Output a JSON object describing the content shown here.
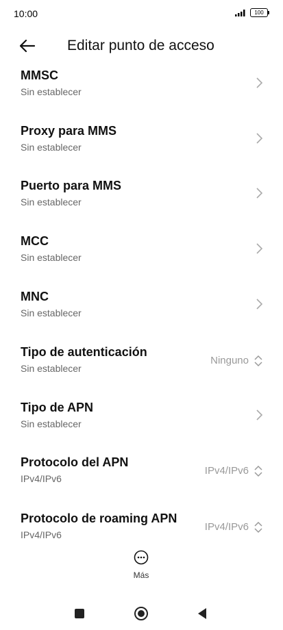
{
  "status": {
    "time": "10:00",
    "battery": "100"
  },
  "header": {
    "title": "Editar punto de acceso"
  },
  "items": [
    {
      "title": "MMSC",
      "subtitle": "Sin establecer"
    },
    {
      "title": "Proxy para MMS",
      "subtitle": "Sin establecer"
    },
    {
      "title": "Puerto para MMS",
      "subtitle": "Sin establecer"
    },
    {
      "title": "MCC",
      "subtitle": "Sin establecer"
    },
    {
      "title": "MNC",
      "subtitle": "Sin establecer"
    },
    {
      "title": "Tipo de autenticación",
      "subtitle": "Sin establecer",
      "value": "Ninguno"
    },
    {
      "title": "Tipo de APN",
      "subtitle": "Sin establecer"
    },
    {
      "title": "Protocolo del APN",
      "subtitle": "IPv4/IPv6",
      "value": "IPv4/IPv6"
    },
    {
      "title": "Protocolo de roaming APN",
      "subtitle": "IPv4/IPv6",
      "value": "IPv4/IPv6"
    }
  ],
  "more": {
    "label": "Más"
  },
  "icons": {
    "back": "arrow-left-icon",
    "chevron": "chevron-right-icon",
    "spinner": "up-down-icon",
    "more": "ellipsis-circle-icon"
  },
  "colors": {
    "text": "#111111",
    "secondary": "#666666",
    "value": "#999999"
  }
}
